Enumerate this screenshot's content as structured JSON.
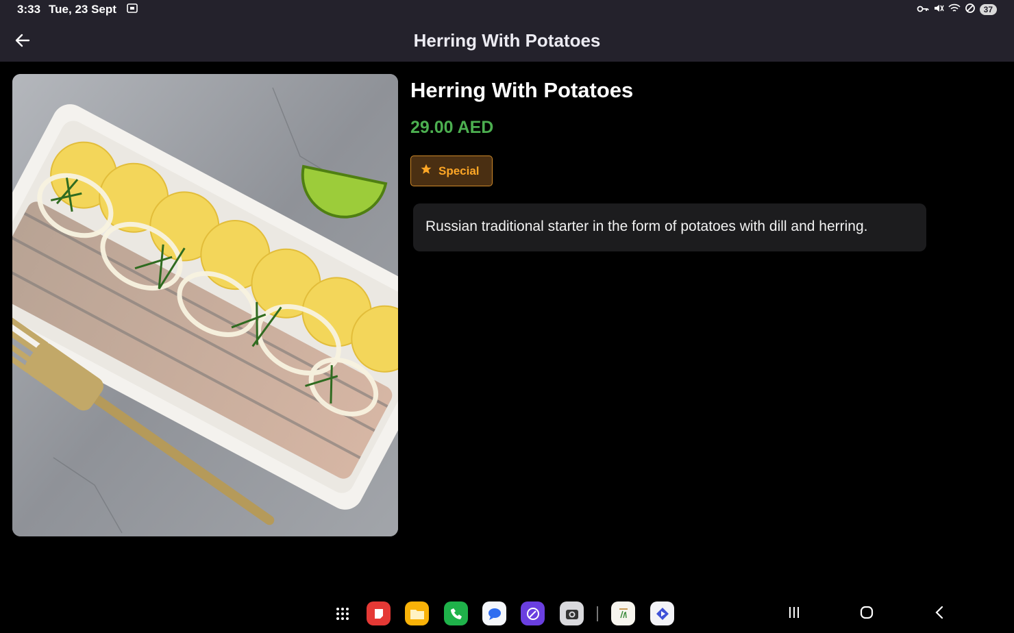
{
  "status": {
    "time": "3:33",
    "date": "Tue, 23 Sept",
    "battery": "37"
  },
  "app_bar": {
    "title": "Herring With Potatoes"
  },
  "dish": {
    "name": "Herring With Potatoes",
    "price": "29.00 AED",
    "badge": "Special",
    "description": "Russian traditional starter in the form of potatoes with dill and herring."
  },
  "dock": {
    "apps": [
      "apps-grid-icon",
      "notes-app-icon",
      "files-app-icon",
      "phone-app-icon",
      "messages-app-icon",
      "browser-app-icon",
      "camera-app-icon",
      "menu-app-icon",
      "play-app-icon"
    ]
  },
  "colors": {
    "price": "#4caf50",
    "badge_text": "#ffa726",
    "badge_bg": "#4a2f12",
    "app_bar": "#24222c"
  }
}
